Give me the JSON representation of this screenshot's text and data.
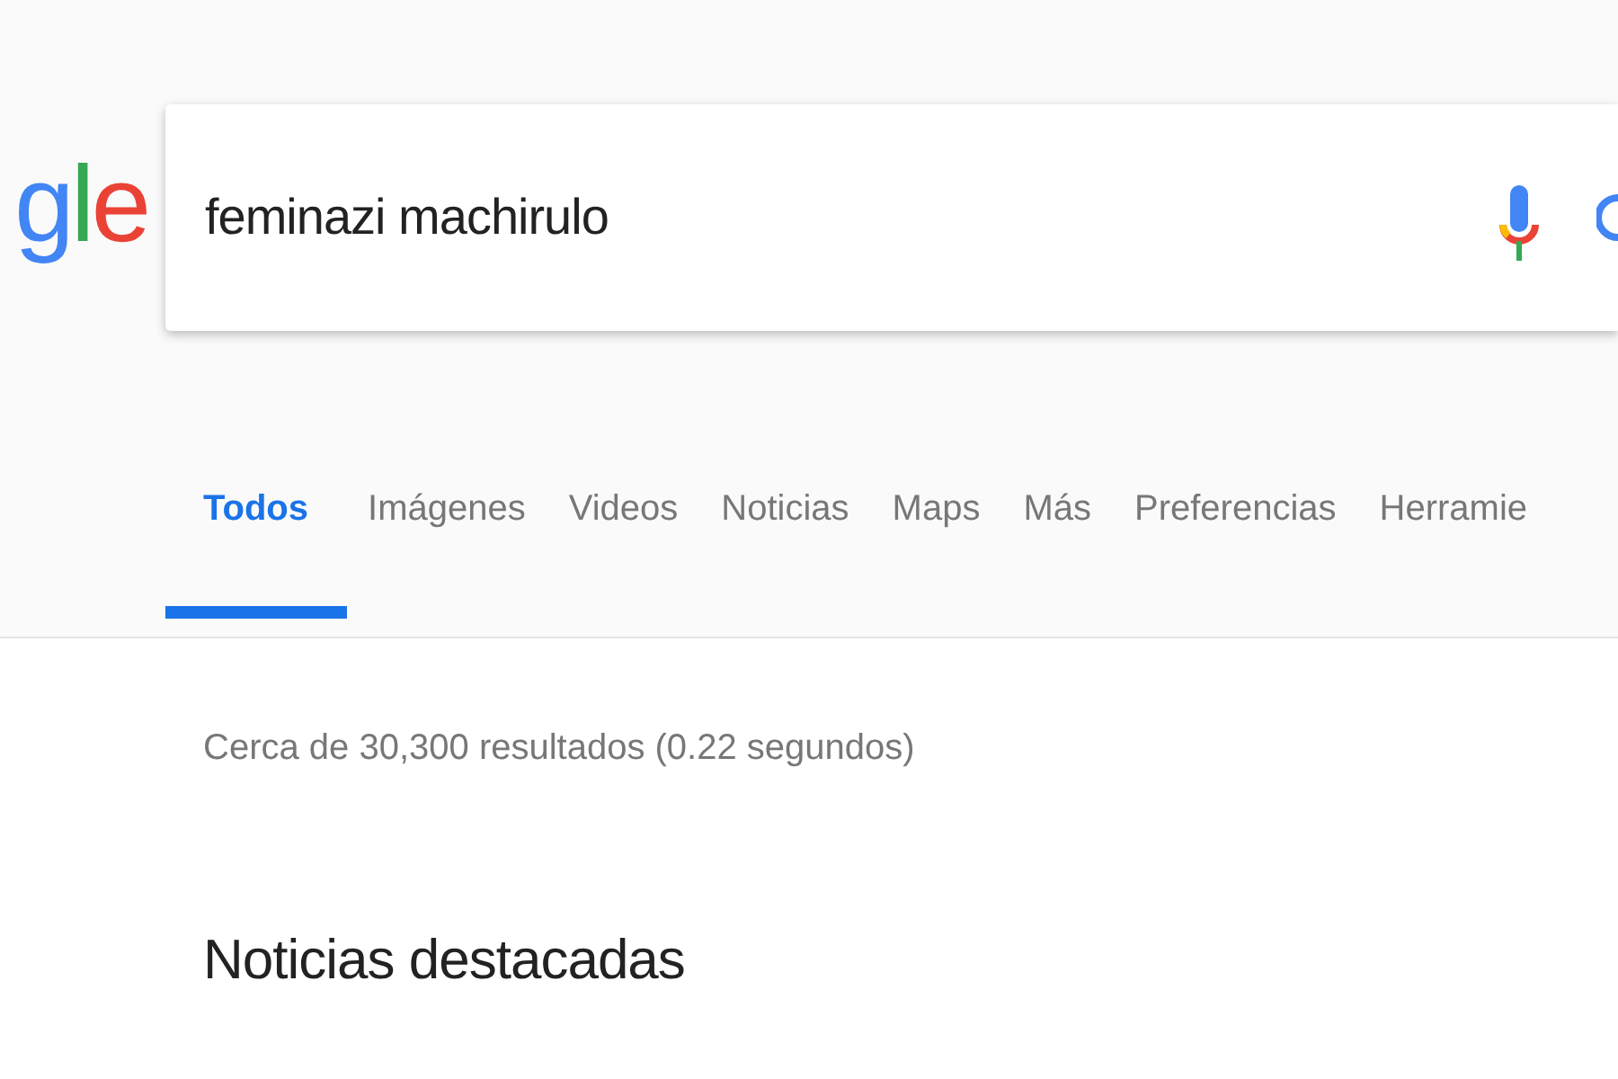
{
  "logo": {
    "letters": [
      {
        "char": "g",
        "color": "#4285f4"
      },
      {
        "char": "l",
        "color": "#34a853"
      },
      {
        "char": "e",
        "color": "#ea4335"
      }
    ]
  },
  "search": {
    "value": "feminazi machirulo"
  },
  "tabs": [
    {
      "label": "Todos",
      "selected": true
    },
    {
      "label": "Imágenes",
      "selected": false
    },
    {
      "label": "Videos",
      "selected": false
    },
    {
      "label": "Noticias",
      "selected": false
    },
    {
      "label": "Maps",
      "selected": false
    },
    {
      "label": "Más",
      "selected": false
    },
    {
      "label": "Preferencias",
      "selected": false
    },
    {
      "label": "Herramie",
      "selected": false
    }
  ],
  "result_stats": "Cerca de 30,300 resultados (0.22 segundos)",
  "section_heading": "Noticias destacadas"
}
